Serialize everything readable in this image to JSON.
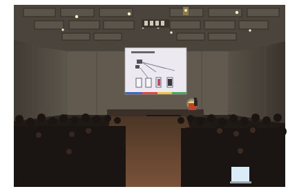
{
  "scene": {
    "slide_title": "",
    "colors": {
      "wall": "#5f564b",
      "ceiling": "#4a443c",
      "screen": "#ece9f1",
      "floor": "#6a4a35",
      "audience": "#1a1512",
      "podium": "#c2431e",
      "laptop_screen": "#d9ecf7"
    }
  }
}
